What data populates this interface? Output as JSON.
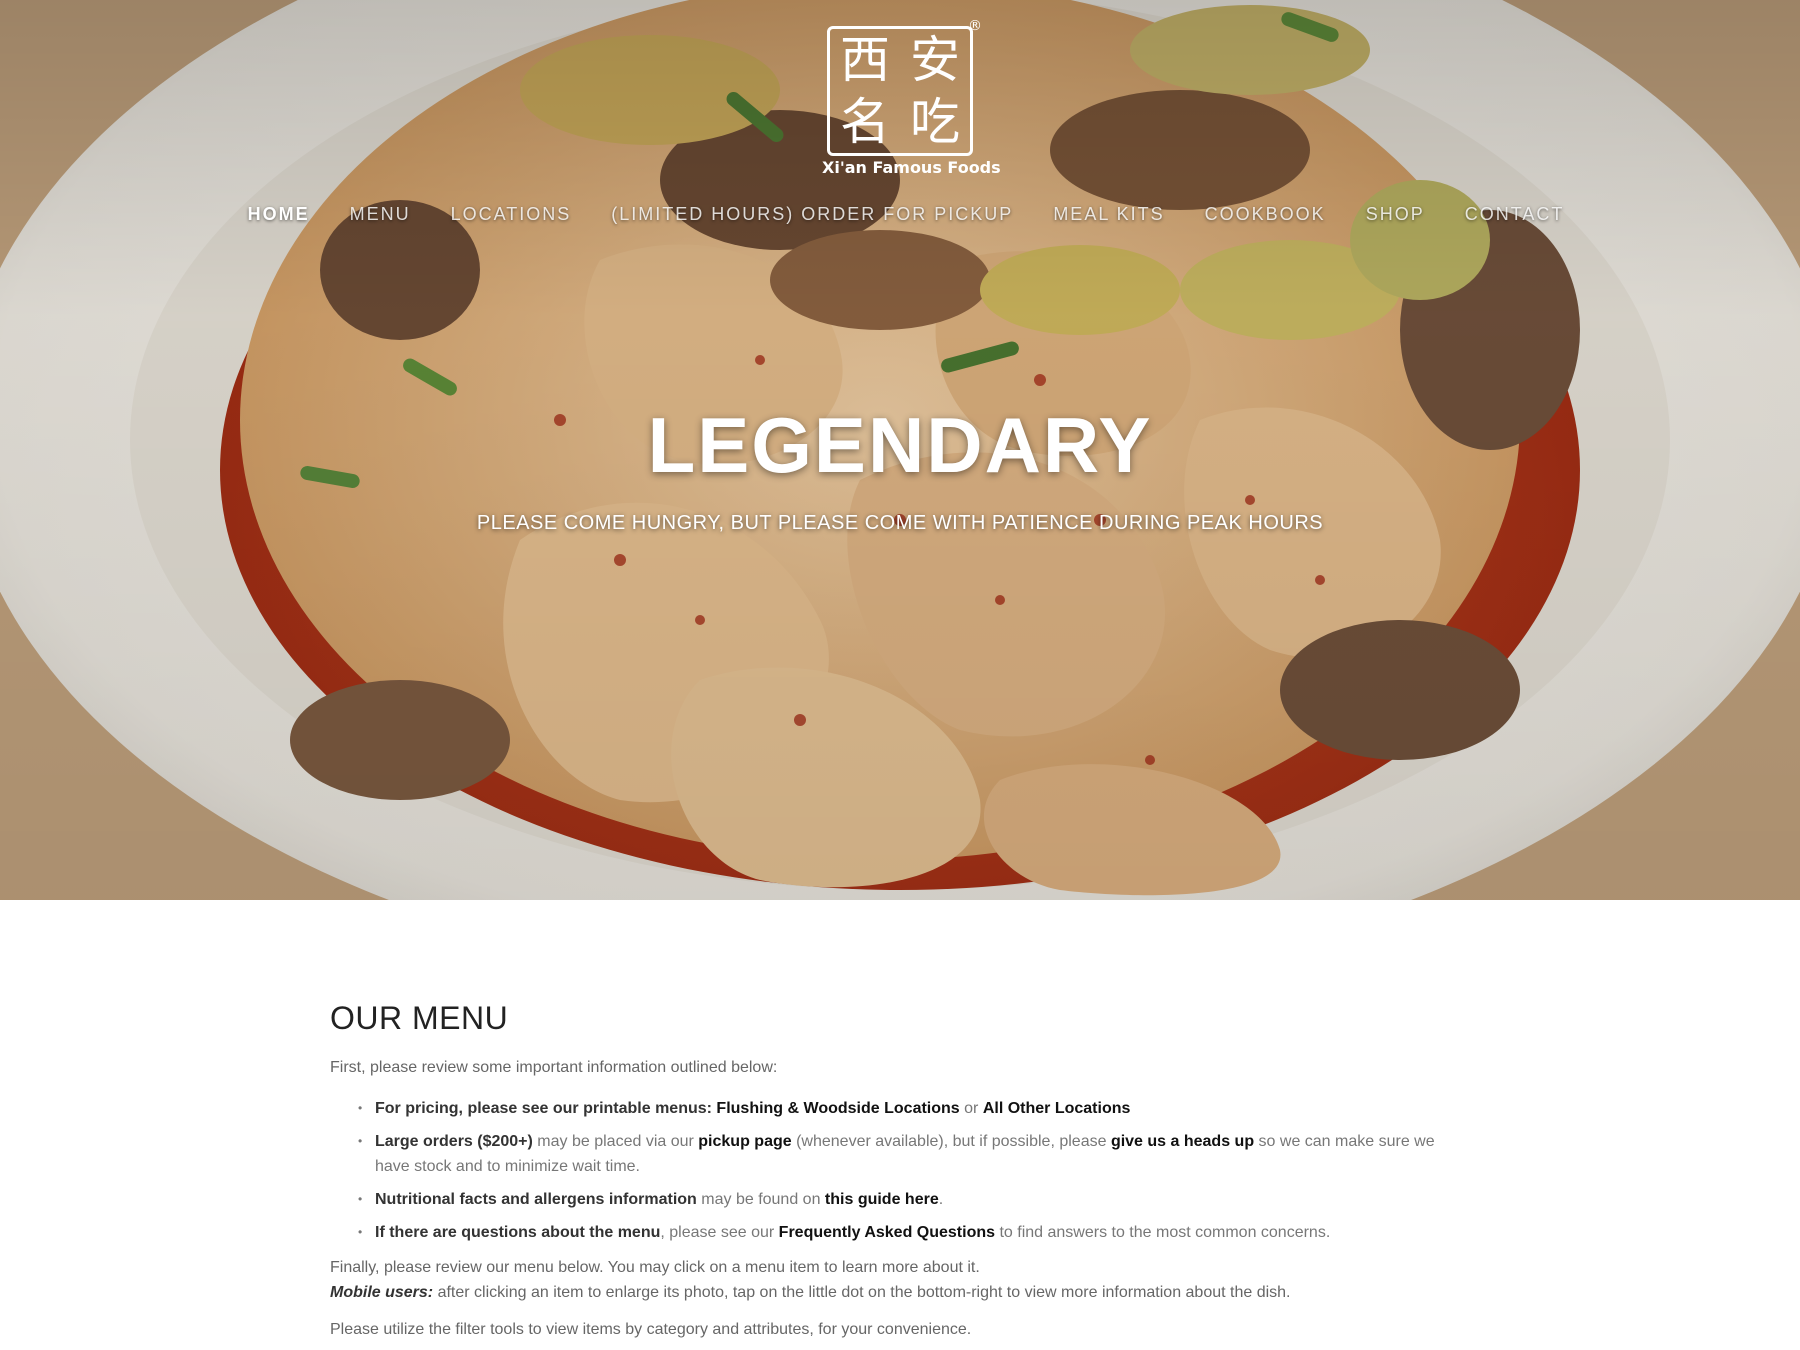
{
  "colors": {
    "hero_overlay": "#000000",
    "heading": "#222222",
    "body_text": "#666666",
    "link": "#111111"
  },
  "logo": {
    "chars": [
      "西",
      "安",
      "名",
      "吃"
    ],
    "registered": "®",
    "name": "Xi'an Famous Foods",
    "icon": "xian-famous-foods-logo"
  },
  "nav": {
    "items": [
      {
        "label": "HOME",
        "active": true
      },
      {
        "label": "MENU",
        "active": false
      },
      {
        "label": "LOCATIONS",
        "active": false
      },
      {
        "label": "(LIMITED HOURS) ORDER FOR PICKUP",
        "active": false
      },
      {
        "label": "MEAL KITS",
        "active": false
      },
      {
        "label": "COOKBOOK",
        "active": false
      },
      {
        "label": "SHOP",
        "active": false
      },
      {
        "label": "CONTACT",
        "active": false
      }
    ]
  },
  "hero": {
    "title": "LEGENDARY",
    "subtitle": "PLEASE COME HUNGRY, BUT PLEASE COME WITH PATIENCE DURING PEAK HOURS"
  },
  "menu_section": {
    "title": "OUR MENU",
    "intro": "First, please review some important information outlined below:",
    "bullet1": {
      "lead": "For pricing, please see our printable menus: ",
      "link1": "Flushing & Woodside Locations",
      "or": " or ",
      "link2": "All Other Locations"
    },
    "bullet2": {
      "lead": "Large orders ($200+)",
      "t1": " may be placed via our ",
      "link1": "pickup page",
      "t2": " (whenever available), but if possible, please ",
      "link2": "give us a heads up",
      "t3": " so we can make sure we have stock and to minimize wait time."
    },
    "bullet3": {
      "lead": "Nutritional facts and allergens information",
      "t1": " may be found on ",
      "link1": "this guide here",
      "t2": "."
    },
    "bullet4": {
      "lead": "If there are questions about the menu",
      "t1": ", please see our ",
      "link1": "Frequently Asked Questions",
      "t2": " to find answers to the most common concerns."
    },
    "finally": "Finally, please review our menu below. You may click on a menu item to learn more about it.",
    "mobile_label": "Mobile users:",
    "mobile_text": " after clicking an item to enlarge its photo,  tap on the little dot on the bottom-right to view more information about the dish.",
    "filter_note": "Please utilize the filter tools to view items by category and attributes, for your convenience."
  }
}
